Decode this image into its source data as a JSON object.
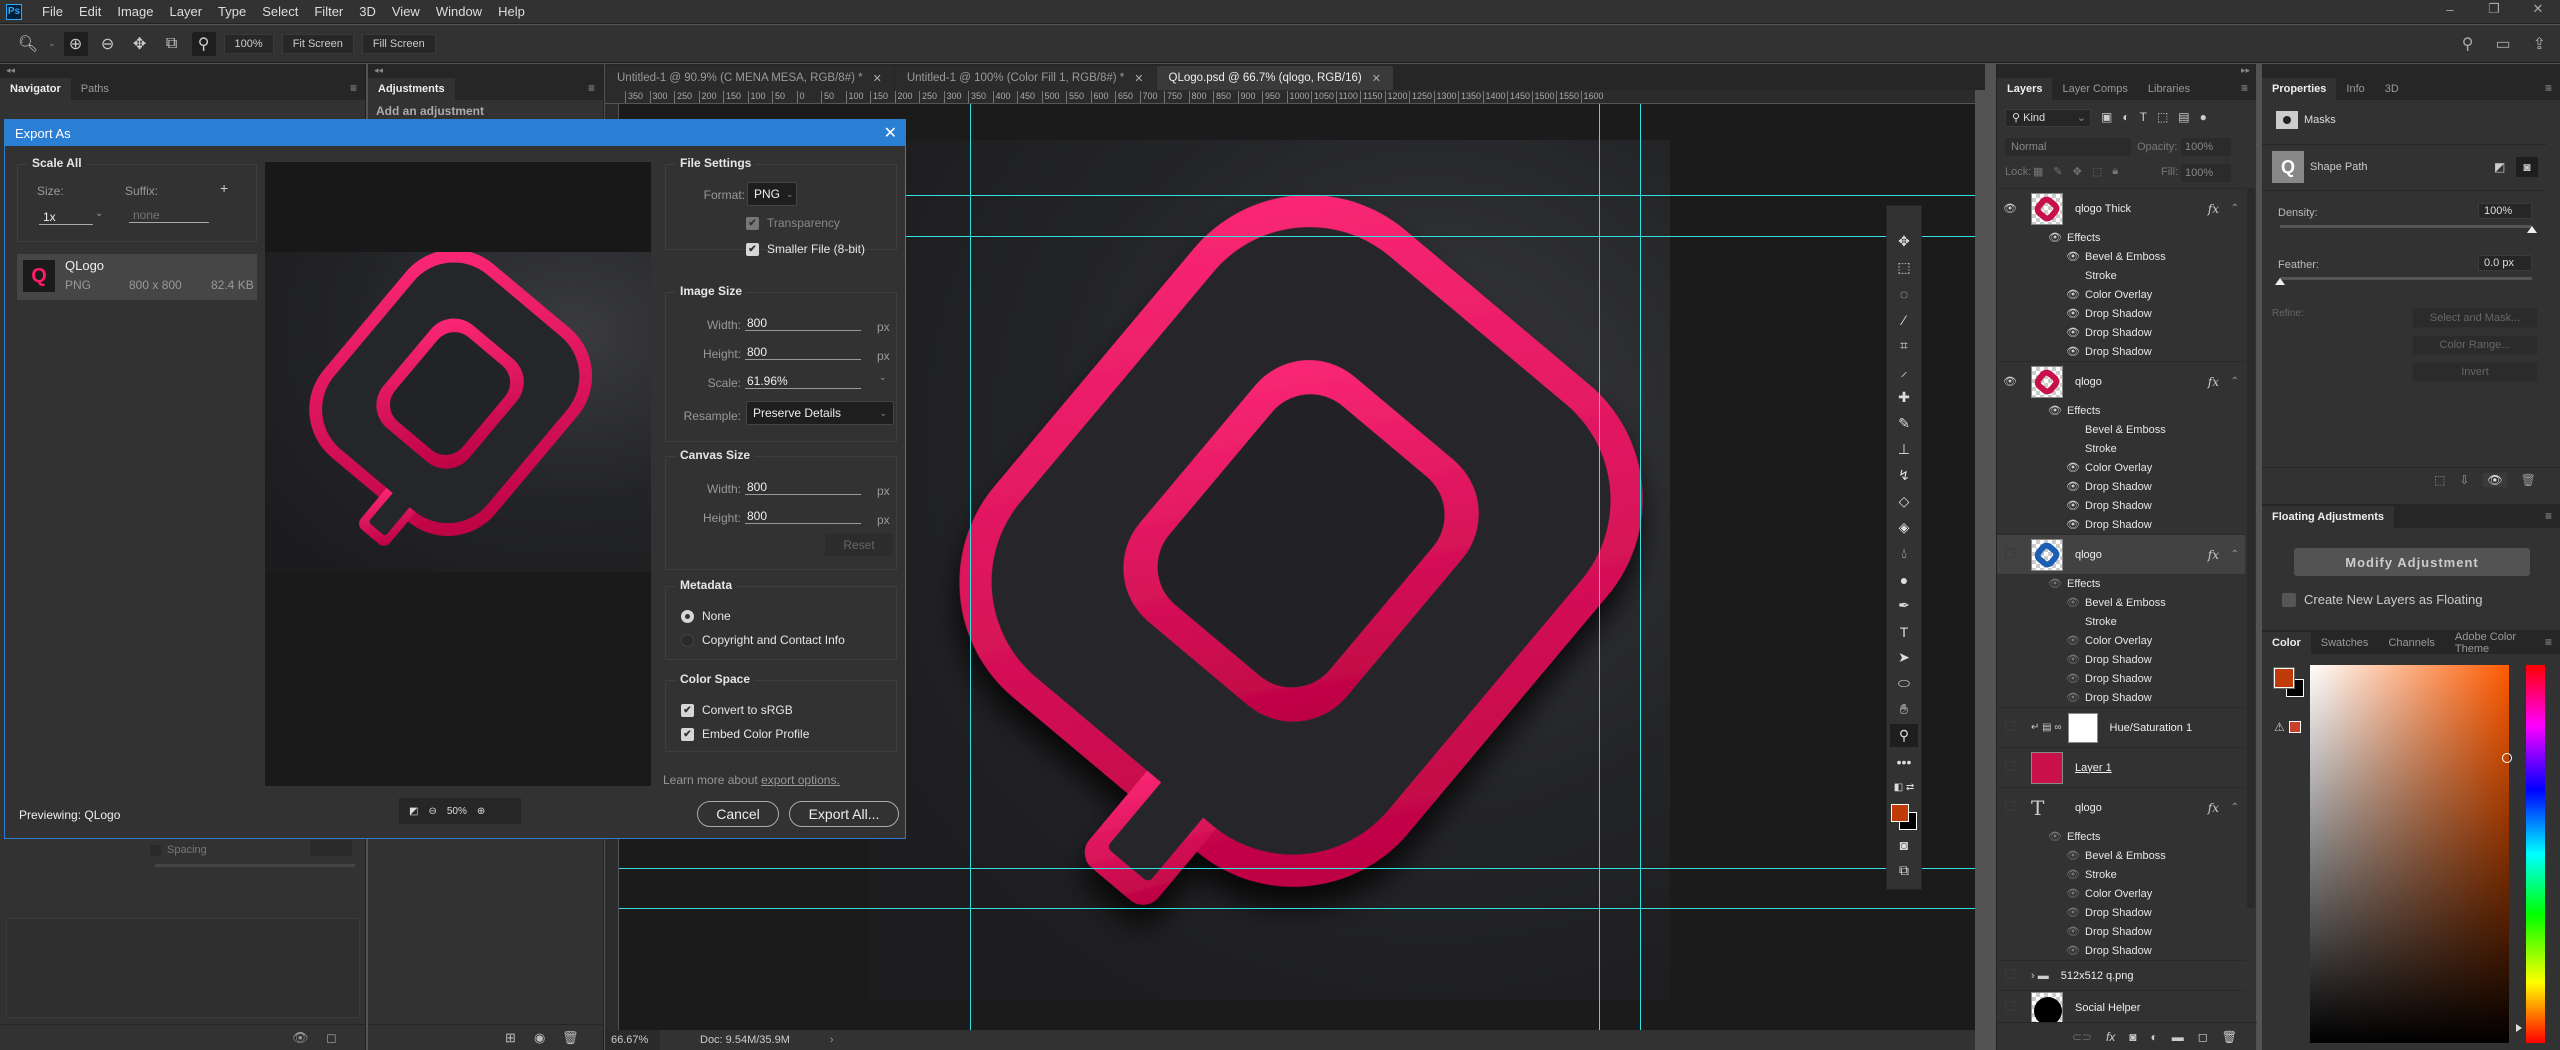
{
  "app": {
    "logo": "Ps"
  },
  "menu": [
    "File",
    "Edit",
    "Image",
    "Layer",
    "Type",
    "Select",
    "Filter",
    "3D",
    "View",
    "Window",
    "Help"
  ],
  "window_controls": {
    "minimize": "–",
    "restore": "❐",
    "close": "✕"
  },
  "options_bar": {
    "zoom_value": "100%",
    "fit_screen": "Fit Screen",
    "fill_screen": "Fill Screen"
  },
  "left_panel": {
    "tabs": [
      "Navigator",
      "Paths"
    ],
    "spacing_label": "Spacing"
  },
  "adjustments_panel": {
    "tab": "Adjustments",
    "subtitle": "Add an adjustment"
  },
  "doc_tabs": [
    {
      "label": "Untitled-1 @ 90.9% (C MENA MESA, RGB/8#) *",
      "active": false
    },
    {
      "label": "Untitled-1 @ 100% (Color Fill 1, RGB/8#) *",
      "active": false
    },
    {
      "label": "QLogo.psd @ 66.7% (qlogo, RGB/16)",
      "active": true
    }
  ],
  "ruler_top": [
    "350",
    "300",
    "250",
    "200",
    "150",
    "100",
    "50",
    "0",
    "50",
    "100",
    "150",
    "200",
    "250",
    "300",
    "350",
    "400",
    "450",
    "500",
    "550",
    "600",
    "650",
    "700",
    "750",
    "800",
    "850",
    "900",
    "950",
    "1000",
    "1050",
    "1100",
    "1150",
    "1200",
    "1250",
    "1300",
    "1350",
    "1400",
    "1450",
    "1500",
    "1550",
    "1600"
  ],
  "status_bar": {
    "zoom": "66.67%",
    "doc": "Doc: 9.54M/35.9M"
  },
  "dialog": {
    "title": "Export As",
    "scale_all": {
      "legend": "Scale All",
      "size_label": "Size:",
      "size_value": "1x",
      "suffix_label": "Suffix:",
      "suffix_placeholder": "none",
      "add": "+"
    },
    "asset": {
      "name": "QLogo",
      "format": "PNG",
      "dimensions": "800 x 800",
      "size": "82.4 KB"
    },
    "file_settings": {
      "legend": "File Settings",
      "format_label": "Format:",
      "format_value": "PNG",
      "transparency": "Transparency",
      "transparency_checked": true,
      "smaller_file": "Smaller File (8-bit)",
      "smaller_file_checked": true
    },
    "image_size": {
      "legend": "Image Size",
      "width_label": "Width:",
      "width": "800",
      "height_label": "Height:",
      "height": "800",
      "scale_label": "Scale:",
      "scale": "61.96%",
      "resample_label": "Resample:",
      "resample": "Preserve Details",
      "unit": "px"
    },
    "canvas_size": {
      "legend": "Canvas Size",
      "width_label": "Width:",
      "width": "800",
      "height_label": "Height:",
      "height": "800",
      "unit": "px",
      "reset": "Reset"
    },
    "metadata": {
      "legend": "Metadata",
      "options": [
        "None",
        "Copyright and Contact Info"
      ],
      "selected": "None"
    },
    "color_space": {
      "legend": "Color Space",
      "convert": "Convert to sRGB",
      "convert_checked": true,
      "embed": "Embed Color Profile",
      "embed_checked": true
    },
    "learn_more": "Learn more about ",
    "learn_link": "export options.",
    "cancel": "Cancel",
    "export_all": "Export All...",
    "previewing": "Previewing: QLogo",
    "preview_zoom": "50%"
  },
  "layers_panel": {
    "tabs": [
      "Layers",
      "Layer Comps",
      "Libraries"
    ],
    "filter_kind": "Kind",
    "blend_mode": "Normal",
    "opacity_label": "Opacity:",
    "opacity": "100%",
    "lock_label": "Lock:",
    "fill_label": "Fill:",
    "fill": "100%",
    "layers": [
      {
        "name": "qlogo Thick",
        "visible": true,
        "fx": true,
        "effects_label": "Effects",
        "effects": [
          {
            "name": "Bevel & Emboss",
            "on": true
          },
          {
            "name": "Stroke",
            "on": false
          },
          {
            "name": "Color Overlay",
            "on": true
          },
          {
            "name": "Drop Shadow",
            "on": true
          },
          {
            "name": "Drop Shadow",
            "on": true
          },
          {
            "name": "Drop Shadow",
            "on": true
          }
        ]
      },
      {
        "name": "qlogo",
        "visible": true,
        "fx": true,
        "effects_label": "Effects",
        "effects": [
          {
            "name": "Bevel & Emboss",
            "on": false
          },
          {
            "name": "Stroke",
            "on": false
          },
          {
            "name": "Color Overlay",
            "on": true
          },
          {
            "name": "Drop Shadow",
            "on": true
          },
          {
            "name": "Drop Shadow",
            "on": true
          },
          {
            "name": "Drop Shadow",
            "on": true
          }
        ]
      },
      {
        "name": "qlogo",
        "visible": false,
        "selected": true,
        "fx": true,
        "effects_label": "Effects",
        "effects": [
          {
            "name": "Bevel & Emboss",
            "on": true
          },
          {
            "name": "Stroke",
            "on": false
          },
          {
            "name": "Color Overlay",
            "on": true
          },
          {
            "name": "Drop Shadow",
            "on": true
          },
          {
            "name": "Drop Shadow",
            "on": true
          },
          {
            "name": "Drop Shadow",
            "on": true
          }
        ]
      },
      {
        "name": "Hue/Saturation 1",
        "visible": false
      },
      {
        "name": "Layer 1",
        "visible": false,
        "color": "#c8104a"
      },
      {
        "name": "qlogo",
        "visible": false,
        "type": "text",
        "fx": true,
        "effects_label": "Effects",
        "effects": [
          {
            "name": "Bevel & Emboss",
            "on": true
          },
          {
            "name": "Stroke",
            "on": true
          },
          {
            "name": "Color Overlay",
            "on": true
          },
          {
            "name": "Drop Shadow",
            "on": true
          },
          {
            "name": "Drop Shadow",
            "on": true
          },
          {
            "name": "Drop Shadow",
            "on": true
          }
        ]
      },
      {
        "name": "512x512 q.png",
        "visible": false,
        "type": "group"
      },
      {
        "name": "Social Helper",
        "visible": false
      }
    ]
  },
  "properties_panel": {
    "tabs": [
      "Properties",
      "Info",
      "3D"
    ],
    "section": "Masks",
    "shape_path": "Shape Path",
    "density_label": "Density:",
    "density": "100%",
    "density_fraction": 1.0,
    "feather_label": "Feather:",
    "feather": "0.0 px",
    "feather_fraction": 0.0,
    "refine_label": "Refine:",
    "select_mask": "Select and Mask...",
    "color_range": "Color Range...",
    "invert": "Invert"
  },
  "floating_adjustments": {
    "tab": "Floating Adjustments",
    "modify": "Modify Adjustment",
    "create_floating": "Create New Layers as Floating"
  },
  "color_panel": {
    "tabs": [
      "Color",
      "Swatches",
      "Channels",
      "Adobe Color Theme"
    ],
    "foreground": "#c03a0a",
    "background": "#000000",
    "hue_color": "#ff5a00"
  },
  "colors": {
    "accent": "#2a7fd4",
    "logo_pink": "#ff1a6a",
    "guide": "#33e0e0"
  }
}
